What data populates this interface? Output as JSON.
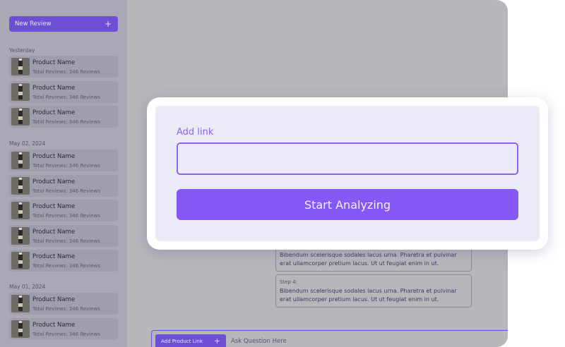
{
  "sidebar": {
    "new_review_label": "New Review",
    "new_review_icon": "+",
    "groups": [
      {
        "label": "Yesterday",
        "items": [
          {
            "name": "Product Name",
            "sub": "Total Reviews: 346 Reviews"
          },
          {
            "name": "Product Name",
            "sub": "Total Reviews: 346 Reviews"
          },
          {
            "name": "Product Name",
            "sub": "Total Reviews: 346 Reviews"
          }
        ]
      },
      {
        "label": "May 02, 2024",
        "items": [
          {
            "name": "Product Name",
            "sub": "Total Reviews: 346 Reviews"
          },
          {
            "name": "Product Name",
            "sub": "Total Reviews: 346 Reviews"
          },
          {
            "name": "Product Name",
            "sub": "Total Reviews: 346 Reviews"
          },
          {
            "name": "Product Name",
            "sub": "Total Reviews: 346 Reviews"
          },
          {
            "name": "Product Name",
            "sub": "Total Reviews: 346 Reviews"
          }
        ]
      },
      {
        "label": "May 01, 2024",
        "items": [
          {
            "name": "Product Name",
            "sub": "Total Reviews: 346 Reviews"
          },
          {
            "name": "Product Name",
            "sub": "Total Reviews: 346 Reviews"
          }
        ]
      }
    ]
  },
  "steps": [
    {
      "title": "",
      "text": "Bibendum scelerisque sodales lacus urna. Pharetra et pulvinar erat ullamcorper pretium lacus. Ut ut feugiat enim in ut."
    },
    {
      "title": "Step 4:",
      "text": "Bibendum scelerisque sodales lacus urna. Pharetra et pulvinar erat ullamcorper pretium lacus. Ut ut feugiat enim in ut."
    }
  ],
  "bottom_bar": {
    "add_product_label": "Add Product Link",
    "add_product_icon": "+",
    "ask_placeholder": "Ask Question Here"
  },
  "modal": {
    "add_link_label": "Add link",
    "link_value": "",
    "start_button_label": "Start Analyzing"
  },
  "colors": {
    "accent": "#8557f5",
    "accent_dark": "#6d4fd3",
    "overlay": "#b7b6bb"
  }
}
